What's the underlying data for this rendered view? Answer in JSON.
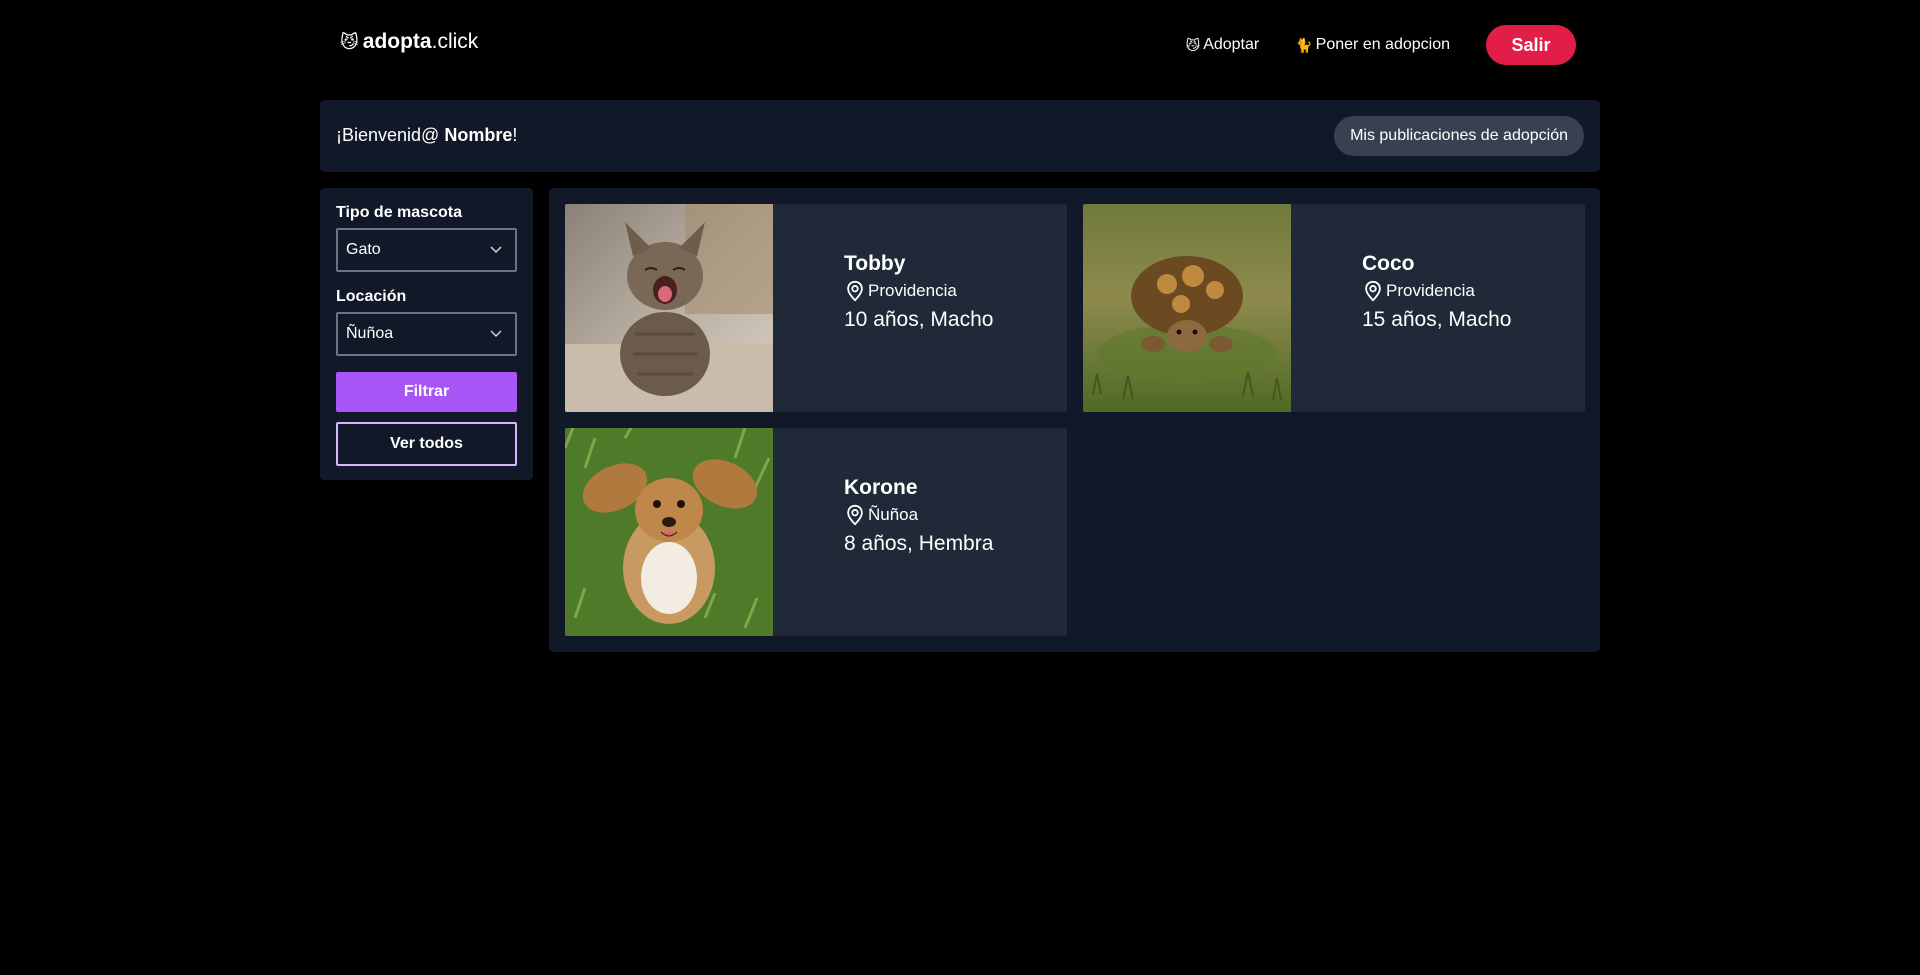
{
  "header": {
    "logo_emoji": "😼",
    "logo_bold": "adopta",
    "logo_rest": ".click",
    "nav": [
      {
        "emoji": "😼",
        "label": "Adoptar"
      },
      {
        "emoji": "🐈",
        "label": "Poner en adopcion"
      }
    ],
    "logout_label": "Salir"
  },
  "welcome": {
    "greeting": "¡Bienvenid@ ",
    "name": "Nombre",
    "suffix": "!",
    "my_posts_label": "Mis publicaciones de adopción"
  },
  "filters": {
    "pet_type_label": "Tipo de mascota",
    "pet_type_value": "Gato",
    "location_label": "Locación",
    "location_value": "Ñuñoa",
    "filter_label": "Filtrar",
    "view_all_label": "Ver todos"
  },
  "pets": [
    {
      "name": "Tobby",
      "location": "Providencia",
      "desc": "10 años, Macho",
      "photo": "kitten"
    },
    {
      "name": "Coco",
      "location": "Providencia",
      "desc": "15 años, Macho",
      "photo": "tortoise"
    },
    {
      "name": "Korone",
      "location": "Ñuñoa",
      "desc": "8 años, Hembra",
      "photo": "dog"
    }
  ],
  "icons": [
    "location-pin-icon",
    "chevron-down-icon"
  ],
  "colors": {
    "accent_red": "#e11d48",
    "accent_purple": "#a855f7",
    "panel": "#111827",
    "card": "#1f2937"
  }
}
